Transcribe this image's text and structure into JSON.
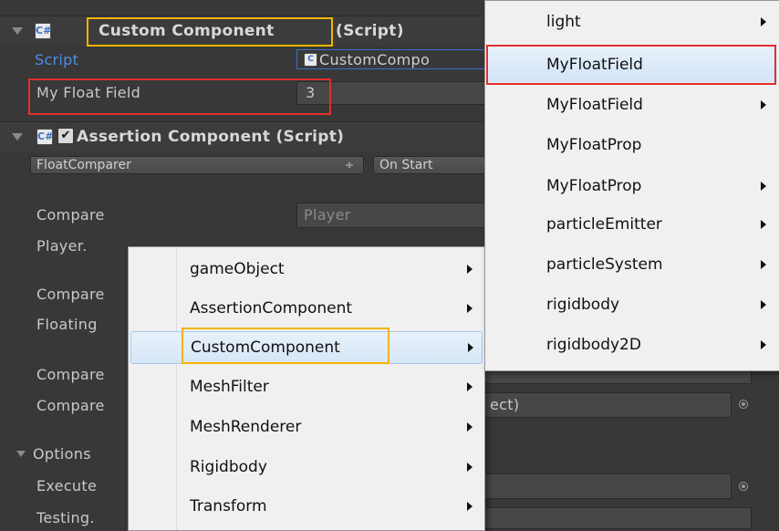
{
  "custom_component": {
    "title": "Custom Component",
    "title_suffix": "(Script)",
    "script_label": "Script",
    "script_value": "CustomCompo",
    "float_field_label": "My Float Field",
    "float_field_value": "3"
  },
  "assertion_component": {
    "title": "Assertion Component (Script)",
    "checkbox_glyph": "✔",
    "comparer_dropdown": "FloatComparer",
    "comparer_dropdown_arrow": "÷",
    "check_dropdown": "On Start",
    "compare_label": "Compare",
    "compare_value": "Player",
    "player_label": "Player.",
    "compare_to_label": "Compare",
    "floating_label": "Floating",
    "compare2_label": "Compare",
    "compare3_label": "Compare",
    "compare3_value": "ect)",
    "options_label": "Options",
    "execute_label": "Execute",
    "testing_label": "Testing."
  },
  "context_menu": {
    "items": [
      {
        "label": "gameObject"
      },
      {
        "label": "AssertionComponent"
      },
      {
        "label": "CustomComponent"
      },
      {
        "label": "MeshFilter"
      },
      {
        "label": "MeshRenderer"
      },
      {
        "label": "Rigidbody"
      },
      {
        "label": "Transform"
      }
    ]
  },
  "submenu": {
    "items": [
      {
        "label": "light",
        "has_submenu": true
      },
      {
        "label": "MyFloatField",
        "has_submenu": false
      },
      {
        "label": "MyFloatField",
        "has_submenu": true
      },
      {
        "label": "MyFloatProp",
        "has_submenu": false
      },
      {
        "label": "MyFloatProp",
        "has_submenu": true
      },
      {
        "label": "particleEmitter",
        "has_submenu": true
      },
      {
        "label": "particleSystem",
        "has_submenu": true
      },
      {
        "label": "rigidbody",
        "has_submenu": true
      },
      {
        "label": "rigidbody2D",
        "has_submenu": true
      }
    ]
  },
  "colors": {
    "background": "#383838",
    "script_link": "#4d8fe6",
    "highlight_red": "#e03030",
    "highlight_yellow": "#f2b500",
    "menu_bg": "#f0f0f0",
    "menu_selected": "#cfe3f7"
  }
}
